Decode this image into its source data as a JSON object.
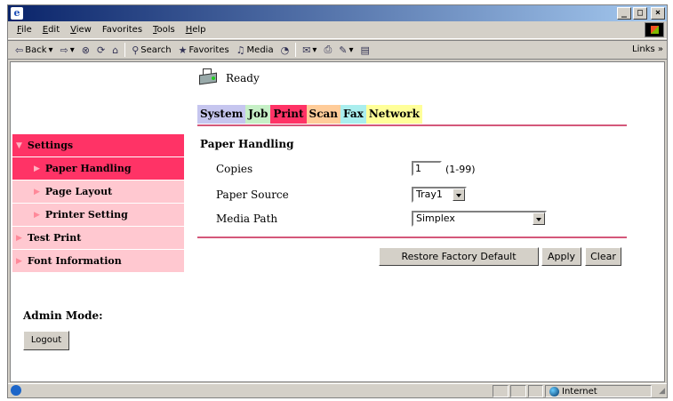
{
  "menu": [
    {
      "u": "F",
      "rest": "ile"
    },
    {
      "u": "E",
      "rest": "dit"
    },
    {
      "u": "V",
      "rest": "iew"
    },
    {
      "u": "Fa",
      "rest": "vorites",
      "pre": ""
    },
    {
      "u": "T",
      "rest": "ools"
    },
    {
      "u": "H",
      "rest": "elp"
    }
  ],
  "toolbar": {
    "back": "Back",
    "search": "Search",
    "favorites": "Favorites",
    "media": "Media",
    "links": "Links"
  },
  "status": {
    "text": "Ready"
  },
  "tabs": [
    "System",
    "Job",
    "Print",
    "Scan",
    "Fax",
    "Network"
  ],
  "sidebar": {
    "items": [
      {
        "label": "Settings"
      },
      {
        "label": "Paper Handling"
      },
      {
        "label": "Page Layout"
      },
      {
        "label": "Printer Setting"
      },
      {
        "label": "Test Print"
      },
      {
        "label": "Font Information"
      }
    ]
  },
  "admin": {
    "label": "Admin Mode:",
    "logout": "Logout"
  },
  "form": {
    "title": "Paper Handling",
    "copies_label": "Copies",
    "copies_value": "1",
    "copies_range": "(1-99)",
    "source_label": "Paper Source",
    "source_value": "Tray1",
    "path_label": "Media Path",
    "path_value": "Simplex"
  },
  "buttons": {
    "restore": "Restore Factory Default",
    "apply": "Apply",
    "clear": "Clear"
  },
  "statusbar": {
    "zone": "Internet"
  }
}
